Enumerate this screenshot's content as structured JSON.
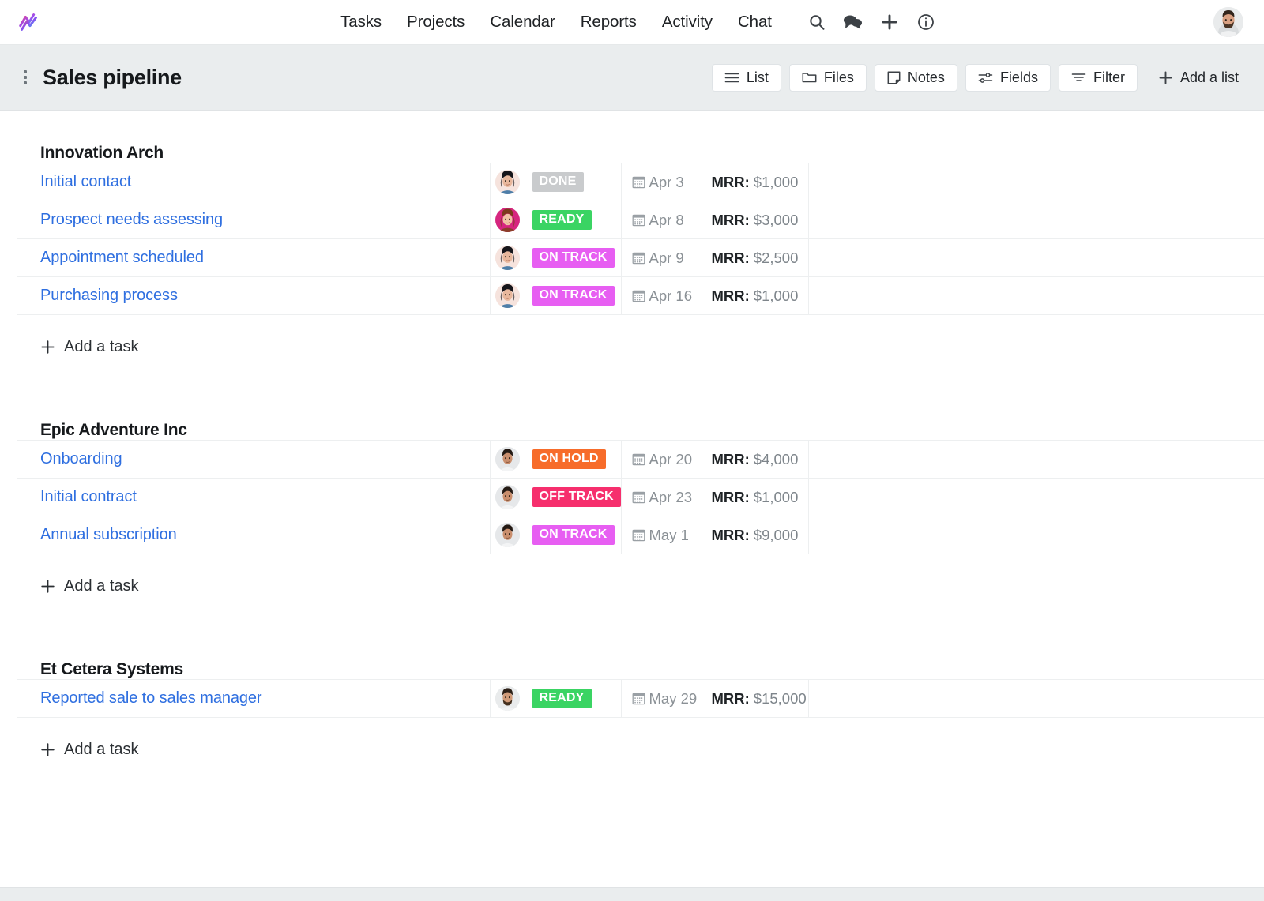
{
  "app": {
    "logo_name": "trend-logo"
  },
  "nav": {
    "links": [
      {
        "label": "Tasks"
      },
      {
        "label": "Projects"
      },
      {
        "label": "Calendar"
      },
      {
        "label": "Reports"
      },
      {
        "label": "Activity"
      },
      {
        "label": "Chat"
      }
    ],
    "icons": [
      {
        "name": "search-icon"
      },
      {
        "name": "chat-bubbles-icon"
      },
      {
        "name": "plus-icon"
      },
      {
        "name": "info-circle-icon"
      }
    ],
    "avatar": {
      "name": "user-avatar"
    }
  },
  "toolbar": {
    "title": "Sales pipeline",
    "menu_icon": "kebab-menu-icon",
    "buttons": [
      {
        "label": "List",
        "icon": "list-icon"
      },
      {
        "label": "Files",
        "icon": "folder-icon"
      },
      {
        "label": "Notes",
        "icon": "note-icon"
      },
      {
        "label": "Fields",
        "icon": "sliders-icon"
      },
      {
        "label": "Filter",
        "icon": "filter-icon"
      },
      {
        "label": "Add a list",
        "icon": "plus-icon"
      }
    ]
  },
  "colors": {
    "link": "#2f6fe0",
    "toolbar_bg": "#eaedee",
    "status_done": "#c9cbcd",
    "status_ready": "#3ad463",
    "status_on_track": "#e75ef2",
    "status_on_hold": "#f76c2a",
    "status_off_track": "#f62f6d"
  },
  "add_task_label": "Add a task",
  "sections": [
    {
      "title": "Innovation Arch",
      "rows": [
        {
          "name": "Initial contact",
          "avatar": "avatar-woman-dark-hair",
          "status": "DONE",
          "status_color": "#c9cbcd",
          "date": "Apr 3",
          "mrr_key": "MRR:",
          "mrr_value": "$1,000"
        },
        {
          "name": "Prospect needs assessing",
          "avatar": "avatar-woman-pink-bg",
          "status": "READY",
          "status_color": "#3ad463",
          "date": "Apr 8",
          "mrr_key": "MRR:",
          "mrr_value": "$3,000"
        },
        {
          "name": "Appointment scheduled",
          "avatar": "avatar-woman-dark-hair",
          "status": "ON TRACK",
          "status_color": "#e75ef2",
          "date": "Apr 9",
          "mrr_key": "MRR:",
          "mrr_value": "$2,500"
        },
        {
          "name": "Purchasing process",
          "avatar": "avatar-woman-dark-hair",
          "status": "ON TRACK",
          "status_color": "#e75ef2",
          "date": "Apr 16",
          "mrr_key": "MRR:",
          "mrr_value": "$1,000"
        }
      ]
    },
    {
      "title": "Epic Adventure Inc",
      "rows": [
        {
          "name": "Onboarding",
          "avatar": "avatar-man-short-hair",
          "status": "ON HOLD",
          "status_color": "#f76c2a",
          "date": "Apr 20",
          "mrr_key": "MRR:",
          "mrr_value": "$4,000"
        },
        {
          "name": "Initial contract",
          "avatar": "avatar-man-short-hair",
          "status": "OFF TRACK",
          "status_color": "#f62f6d",
          "date": "Apr 23",
          "mrr_key": "MRR:",
          "mrr_value": "$1,000"
        },
        {
          "name": "Annual subscription",
          "avatar": "avatar-man-short-hair",
          "status": "ON TRACK",
          "status_color": "#e75ef2",
          "date": "May 1",
          "mrr_key": "MRR:",
          "mrr_value": "$9,000"
        }
      ]
    },
    {
      "title": "Et Cetera Systems",
      "rows": [
        {
          "name": "Reported sale to sales manager",
          "avatar": "avatar-man-beard",
          "status": "READY",
          "status_color": "#3ad463",
          "date": "May 29",
          "mrr_key": "MRR:",
          "mrr_value": "$15,000"
        }
      ]
    }
  ]
}
